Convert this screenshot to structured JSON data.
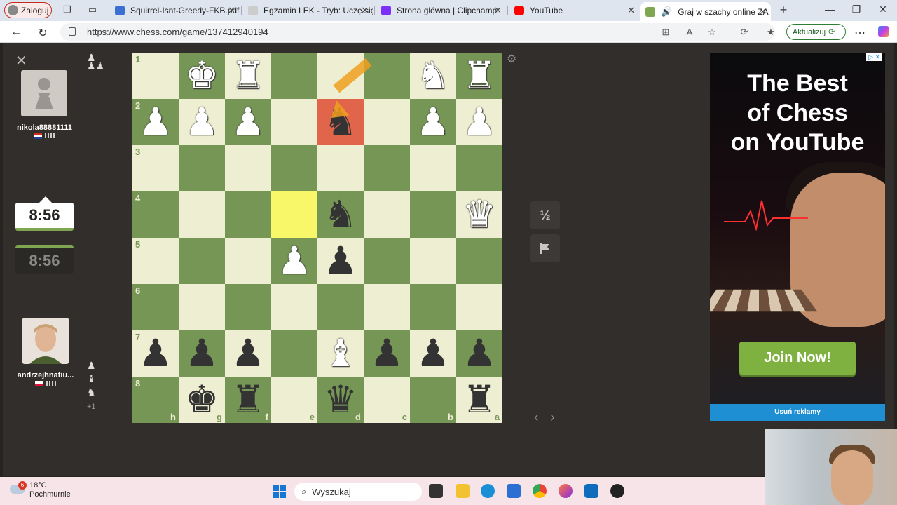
{
  "browser": {
    "profile_label": "Zaloguj",
    "tabs": [
      {
        "label": "Squirrel-Isnt-Greedy-FKB.pdf",
        "icon": "pdf-icon",
        "color": "#3b6fd4"
      },
      {
        "label": "Egzamin LEK - Tryb: Uczę się - T",
        "icon": "page-icon",
        "color": "#999999"
      },
      {
        "label": "Strona główna | Clipchamp",
        "icon": "clipchamp-icon",
        "color": "#7b2ff7"
      },
      {
        "label": "YouTube",
        "icon": "youtube-icon",
        "color": "#ff0000"
      },
      {
        "label": "Graj w szachy online ZA D",
        "icon": "chess-icon",
        "color": "#7fa650",
        "active": true
      }
    ],
    "url": "https://www.chess.com/game/137412940194",
    "update_label": "Aktualizuj"
  },
  "game": {
    "top_player": {
      "name": "nikola88881111",
      "clock": "8:56"
    },
    "bottom_player": {
      "name": "andrzejhnatiu...",
      "clock": "8:56",
      "material_advantage": "+1"
    },
    "draw_label": "½",
    "ranks": [
      "1",
      "2",
      "3",
      "4",
      "5",
      "6",
      "7",
      "8"
    ],
    "files": [
      "h",
      "g",
      "f",
      "e",
      "d",
      "c",
      "b",
      "a"
    ],
    "board": [
      [
        null,
        "wK",
        "wR",
        null,
        null,
        null,
        "wN",
        "wR"
      ],
      [
        "wP",
        "wP",
        "wP",
        null,
        "bN",
        null,
        "wP",
        "wP"
      ],
      [
        null,
        null,
        null,
        null,
        null,
        null,
        null,
        null
      ],
      [
        null,
        null,
        null,
        null,
        "bN",
        null,
        null,
        "wQ"
      ],
      [
        null,
        null,
        null,
        "wP",
        "bP",
        null,
        null,
        null
      ],
      [
        null,
        null,
        null,
        null,
        null,
        null,
        null,
        null
      ],
      [
        "bP",
        "bP",
        "bP",
        null,
        "wB",
        "bP",
        "bP",
        "bP"
      ],
      [
        null,
        "bK",
        "bR",
        null,
        "bQ",
        null,
        null,
        "bR"
      ]
    ],
    "highlight_from": "e4",
    "highlight_to": "d2"
  },
  "ad": {
    "headline_lines": [
      "The Best",
      "of Chess",
      "on YouTube"
    ],
    "cta": "Join Now!",
    "remove_label": "Usuń reklamy"
  },
  "taskbar": {
    "temperature": "18°C",
    "weather": "Pochmurnie",
    "weather_badge": "6",
    "search_placeholder": "Wyszukaj"
  }
}
